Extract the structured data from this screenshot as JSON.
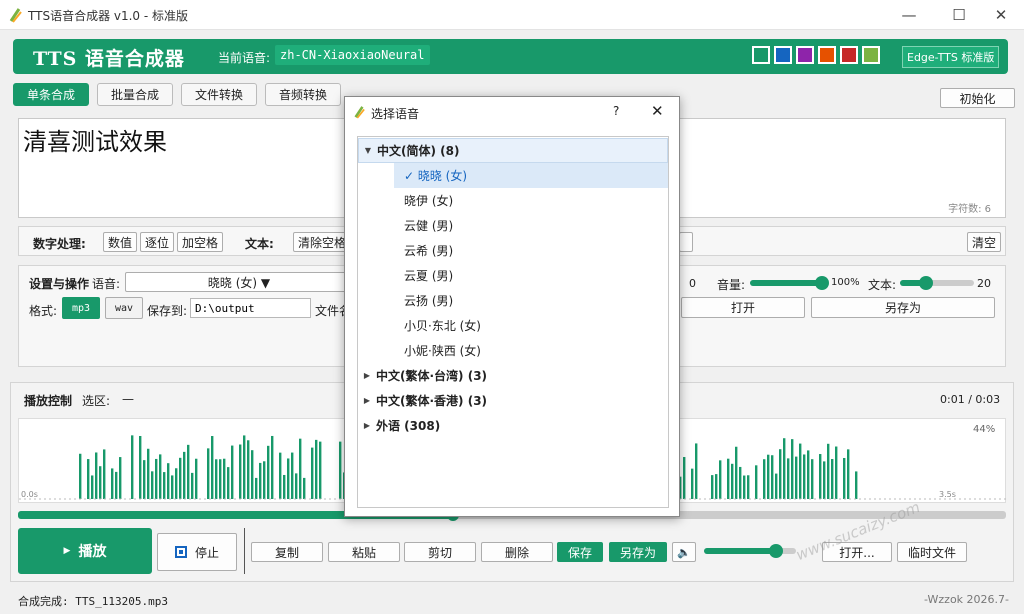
{
  "window": {
    "title": "TTS语音合成器 v1.0 - 标准版",
    "min_icon": "minimize-icon",
    "max_icon": "maximize-icon",
    "close_icon": "close-icon"
  },
  "header": {
    "app_title": "TTS 语音合成器",
    "current_voice_label": "当前语音:",
    "current_voice_value": "zh-CN-XiaoxiaoNeural",
    "theme_colors": [
      "#18996a",
      "#1565c0",
      "#8e24aa",
      "#e65100",
      "#c62828",
      "#7cb342"
    ],
    "edition": "Edge-TTS 标准版"
  },
  "tabs": [
    {
      "label": "单条合成",
      "active": true
    },
    {
      "label": "批量合成",
      "active": false
    },
    {
      "label": "文件转换",
      "active": false
    },
    {
      "label": "音频转换",
      "active": false
    }
  ],
  "init_button": "初始化",
  "editor": {
    "text": "清喜测试效果",
    "char_count": "字符数: 6"
  },
  "number_processing": {
    "label": "数字处理:",
    "buttons": [
      "数值",
      "逐位",
      "加空格"
    ],
    "text_label": "文本:",
    "clear_space": "清除空格",
    "clear": "清空"
  },
  "settings": {
    "label": "设置与操作",
    "voice_label": "语音:",
    "voice_value": "晓晓 (女) ▼",
    "rate_value": "0",
    "volume_label": "音量:",
    "volume_value": "100%",
    "volume_level": 0.92,
    "text_size_label": "文本:",
    "text_size_value": "20",
    "text_size_level": 0.35,
    "format_label": "格式:",
    "format_mp3": "mp3",
    "format_wav": "wav",
    "save_to_label": "保存到:",
    "save_path": "D:\\output",
    "filename_label": "文件名",
    "open_button": "打开",
    "save_as_button": "另存为"
  },
  "playback": {
    "label": "播放控制",
    "selection_label": "选区:",
    "selection_value": "—",
    "time": "0:01 / 0:03",
    "percent": "44%",
    "start_label": "0.0s",
    "end_label": "3.5s",
    "progress": 0.44,
    "play_button": "播放",
    "stop_button": "停止",
    "copy": "复制",
    "paste": "粘贴",
    "cut": "剪切",
    "delete": "删除",
    "save": "保存",
    "save_as": "另存为",
    "volume_level": 0.78,
    "open": "打开...",
    "temp_file": "临时文件"
  },
  "dialog": {
    "title": "选择语音",
    "help": "?",
    "groups": [
      {
        "label": "中文(简体) (8)",
        "expanded": true,
        "children": [
          "✓ 晓晓 (女)",
          "晓伊 (女)",
          "云健 (男)",
          "云希 (男)",
          "云夏 (男)",
          "云扬 (男)",
          "小贝·东北 (女)",
          "小妮·陕西 (女)"
        ]
      },
      {
        "label": "中文(繁体·台湾) (3)",
        "expanded": false,
        "children": []
      },
      {
        "label": "中文(繁体·香港) (3)",
        "expanded": false,
        "children": []
      },
      {
        "label": "外语 (308)",
        "expanded": false,
        "children": []
      }
    ]
  },
  "status": {
    "message": "合成完成:  TTS_113205.mp3",
    "brand": "-Wzzok 2026.7-"
  },
  "watermark": "www.sucaizy.com"
}
